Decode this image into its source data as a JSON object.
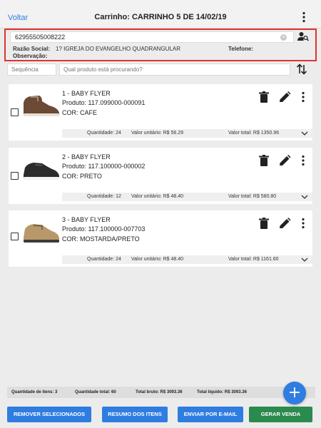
{
  "header": {
    "back_label": "Voltar",
    "title": "Carrinho: CARRINHO 5 DE 14/02/19"
  },
  "customer": {
    "search_value": "62955505008222",
    "razao_social_label": "Razão Social:",
    "razao_social_value": "1? IGREJA DO EVANGELHO QUADRANGULAR",
    "telefone_label": "Telefone:",
    "observacao_label": "Observação:"
  },
  "filters": {
    "sequence_placeholder": "Sequência",
    "search_placeholder": "Qual produto está procurando?"
  },
  "items": [
    {
      "name": "1 - BABY FLYER",
      "product": "Produto: 117.099000-000091",
      "color": "COR: CAFE",
      "quantity": "Quantidade: 24",
      "unit_value": "Valor unitário: R$ 56.29",
      "total_value": "Valor total: R$ 1350.96",
      "shoe_color": "#6b4a36"
    },
    {
      "name": "2 - BABY FLYER",
      "product": "Produto: 117.100000-000002",
      "color": "COR: PRETO",
      "quantity": "Quantidade: 12",
      "unit_value": "Valor unitário: R$ 48.40",
      "total_value": "Valor total: R$ 580.80",
      "shoe_color": "#2b2b2b"
    },
    {
      "name": "3 - BABY FLYER",
      "product": "Produto: 117.100000-007703",
      "color": "COR: MOSTARDA/PRETO",
      "quantity": "Quantidade: 24",
      "unit_value": "Valor unitário: R$ 48.40",
      "total_value": "Valor total: R$ 1161.60",
      "shoe_color": "#b89868"
    }
  ],
  "summary": {
    "item_count": "Quantidade de itens: 3",
    "total_quantity": "Quantidade total: 60",
    "gross_total": "Total bruto: R$ 3093.36",
    "net_total": "Total líquido: R$ 3093.36"
  },
  "actions": {
    "remove_selected": "REMOVER SELECIONADOS",
    "items_summary": "RESUMO DOS ITENS",
    "send_email": "ENVIAR POR E-MAIL",
    "generate_sale": "GERAR VENDA"
  },
  "fab": {
    "label": "+"
  },
  "icons": {
    "back": "none",
    "menu": "vertical-dots-icon",
    "clear": "clear-icon",
    "person_search": "person-search-icon",
    "sort": "sort-arrows-icon",
    "trash": "trash-icon",
    "edit": "pencil-icon",
    "item_menu": "vertical-dots-icon",
    "expand": "chevron-down-icon"
  },
  "colors": {
    "accent": "#2f7de1",
    "success": "#2b8a4e",
    "highlight": "#e0342f"
  }
}
